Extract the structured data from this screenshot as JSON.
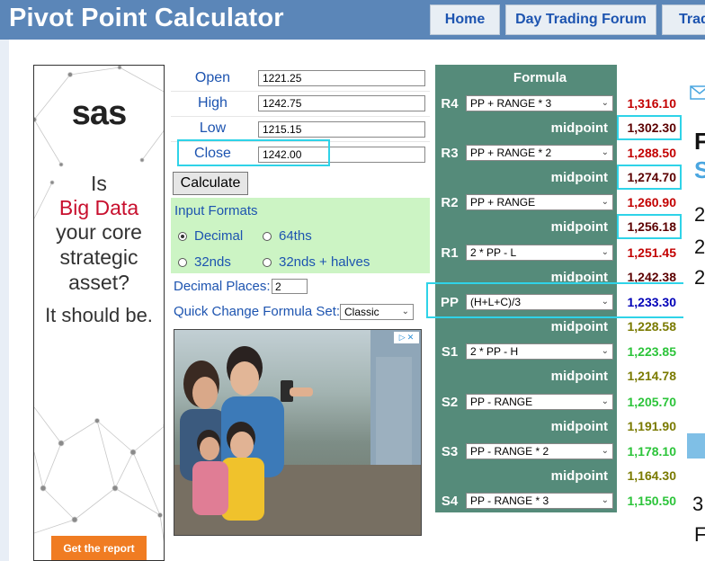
{
  "site": {
    "title": "Pivot Point Calculator"
  },
  "nav": [
    {
      "label": "Home"
    },
    {
      "label": "Day Trading Forum"
    },
    {
      "label": "Trad"
    }
  ],
  "ad_left": {
    "brand": "sas",
    "lines": [
      "Is",
      "Big Data",
      "your core",
      "strategic",
      "asset?",
      "It should be."
    ],
    "cta": "Get the report"
  },
  "inputs": {
    "open": {
      "label": "Open",
      "value": "1221.25"
    },
    "high": {
      "label": "High",
      "value": "1242.75"
    },
    "low": {
      "label": "Low",
      "value": "1215.15"
    },
    "close": {
      "label": "Close",
      "value": "1242.00"
    }
  },
  "calculate_label": "Calculate",
  "formats": {
    "title": "Input Formats",
    "options": [
      "Decimal",
      "64ths",
      "32nds",
      "32nds + halves"
    ],
    "selected": "Decimal"
  },
  "decimal_places": {
    "label": "Decimal Places:",
    "value": "2"
  },
  "formula_set": {
    "label": "Quick Change Formula Set:",
    "value": "Classic"
  },
  "formula_header": "Formula",
  "midpoint_label": "midpoint",
  "levels": [
    {
      "label": "R4",
      "formula": "PP + RANGE * 3",
      "value": "1,316.10"
    },
    {
      "label": "R3",
      "formula": "PP + RANGE * 2",
      "value": "1,288.50"
    },
    {
      "label": "R2",
      "formula": "PP + RANGE",
      "value": "1,260.90"
    },
    {
      "label": "R1",
      "formula": "2 * PP - L",
      "value": "1,251.45"
    },
    {
      "label": "PP",
      "formula": "(H+L+C)/3",
      "value": "1,233.30"
    },
    {
      "label": "S1",
      "formula": "2 * PP - H",
      "value": "1,223.85"
    },
    {
      "label": "S2",
      "formula": "PP - RANGE",
      "value": "1,205.70"
    },
    {
      "label": "S3",
      "formula": "PP - RANGE * 2",
      "value": "1,178.10"
    },
    {
      "label": "S4",
      "formula": "PP - RANGE * 3",
      "value": "1,150.50"
    }
  ],
  "midpoints": [
    "1,302.30",
    "1,274.70",
    "1,256.18",
    "1,242.38",
    "1,228.58",
    "1,214.78",
    "1,191.90",
    "1,164.30"
  ],
  "ad_right_chars": [
    "F",
    "S",
    "2",
    "2",
    "2",
    "3",
    "F"
  ],
  "colors": {
    "header_bg": "#5b86b8",
    "table_bg": "#558b7a",
    "highlight": "#2fd3e8",
    "resistance": "#c30000",
    "pivot": "#0000b8",
    "support": "#2cc43a",
    "mid_upper": "#5c0000",
    "mid_lower": "#7a7a00"
  }
}
